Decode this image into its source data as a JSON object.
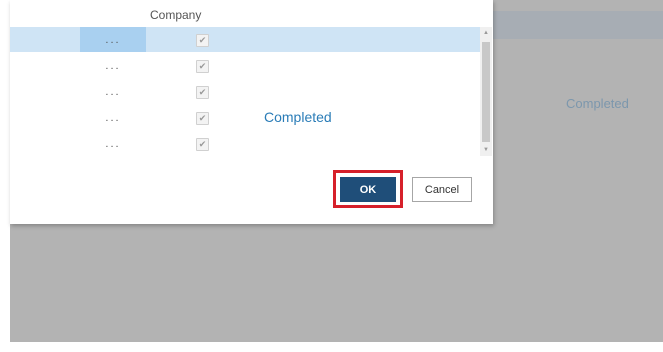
{
  "dialog": {
    "column_header": "Company",
    "rows": [
      {
        "menu_label": "...",
        "checked": true,
        "checkmark": "✔",
        "status": ""
      },
      {
        "menu_label": "...",
        "checked": true,
        "checkmark": "✔",
        "status": ""
      },
      {
        "menu_label": "...",
        "checked": true,
        "checkmark": "✔",
        "status": ""
      },
      {
        "menu_label": "...",
        "checked": true,
        "checkmark": "✔",
        "status": "Completed"
      },
      {
        "menu_label": "...",
        "checked": true,
        "checkmark": "✔",
        "status": ""
      }
    ],
    "ok_label": "OK",
    "cancel_label": "Cancel",
    "scroll_up_icon": "▲",
    "scroll_down_icon": "▼"
  },
  "background": {
    "status_text": "Completed"
  },
  "colors": {
    "selected_row": "#cfe4f5",
    "ok_button": "#1f4e79",
    "highlight": "#d6202a",
    "status_text": "#2a7cb7"
  }
}
